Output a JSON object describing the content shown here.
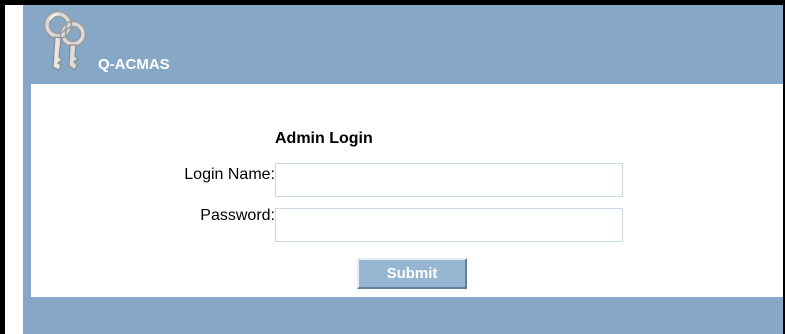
{
  "header": {
    "app_title": "Q-ACMAS",
    "logo_icon": "keys-icon"
  },
  "login_form": {
    "title": "Admin Login",
    "login_name_label": "Login Name:",
    "login_name_value": "",
    "password_label": "Password:",
    "password_value": "",
    "submit_label": "Submit"
  },
  "colors": {
    "frame": "#86a7c5",
    "button": "#97b6d2",
    "content_bg": "#ffffff"
  }
}
